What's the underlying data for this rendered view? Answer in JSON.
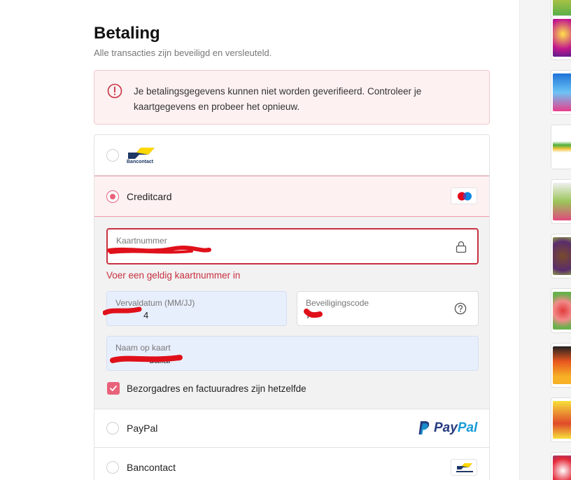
{
  "page": {
    "title": "Betaling",
    "subtitle": "Alle transacties zijn beveiligd en versleuteld."
  },
  "alert": {
    "icon": "alert-circle-icon",
    "text": "Je betalingsgegevens kunnen niet worden geverifieerd. Controleer je kaartgegevens en probeer het opnieuw.",
    "color": "#c8303f"
  },
  "payment_options": {
    "bancontact_logo_text": "Bancontact",
    "creditcard_label": "Creditcard",
    "paypal_label": "PayPal",
    "paypal_logo_text": "PayPal",
    "bancontact_label": "Bancontact"
  },
  "form": {
    "card_number_label": "Kaartnummer",
    "card_number_error": "Voer een geldig kaartnummer in",
    "expiry_label": "Vervaldatum (MM/JJ)",
    "expiry_value_visible": "4",
    "cvc_label": "Beveiligingscode",
    "cvc_value_visible": "7",
    "name_label": "Naam op kaart",
    "name_value_visible": "uallal",
    "same_address_label": "Bezorgadres en factuuradres zijn hetzelfde",
    "same_address_checked": true
  },
  "colors": {
    "accent": "#e8627a",
    "error": "#c8303f",
    "alert_bg": "#fdf1f2",
    "autofill_bg": "#e8effc",
    "redaction": "#e0101a"
  }
}
